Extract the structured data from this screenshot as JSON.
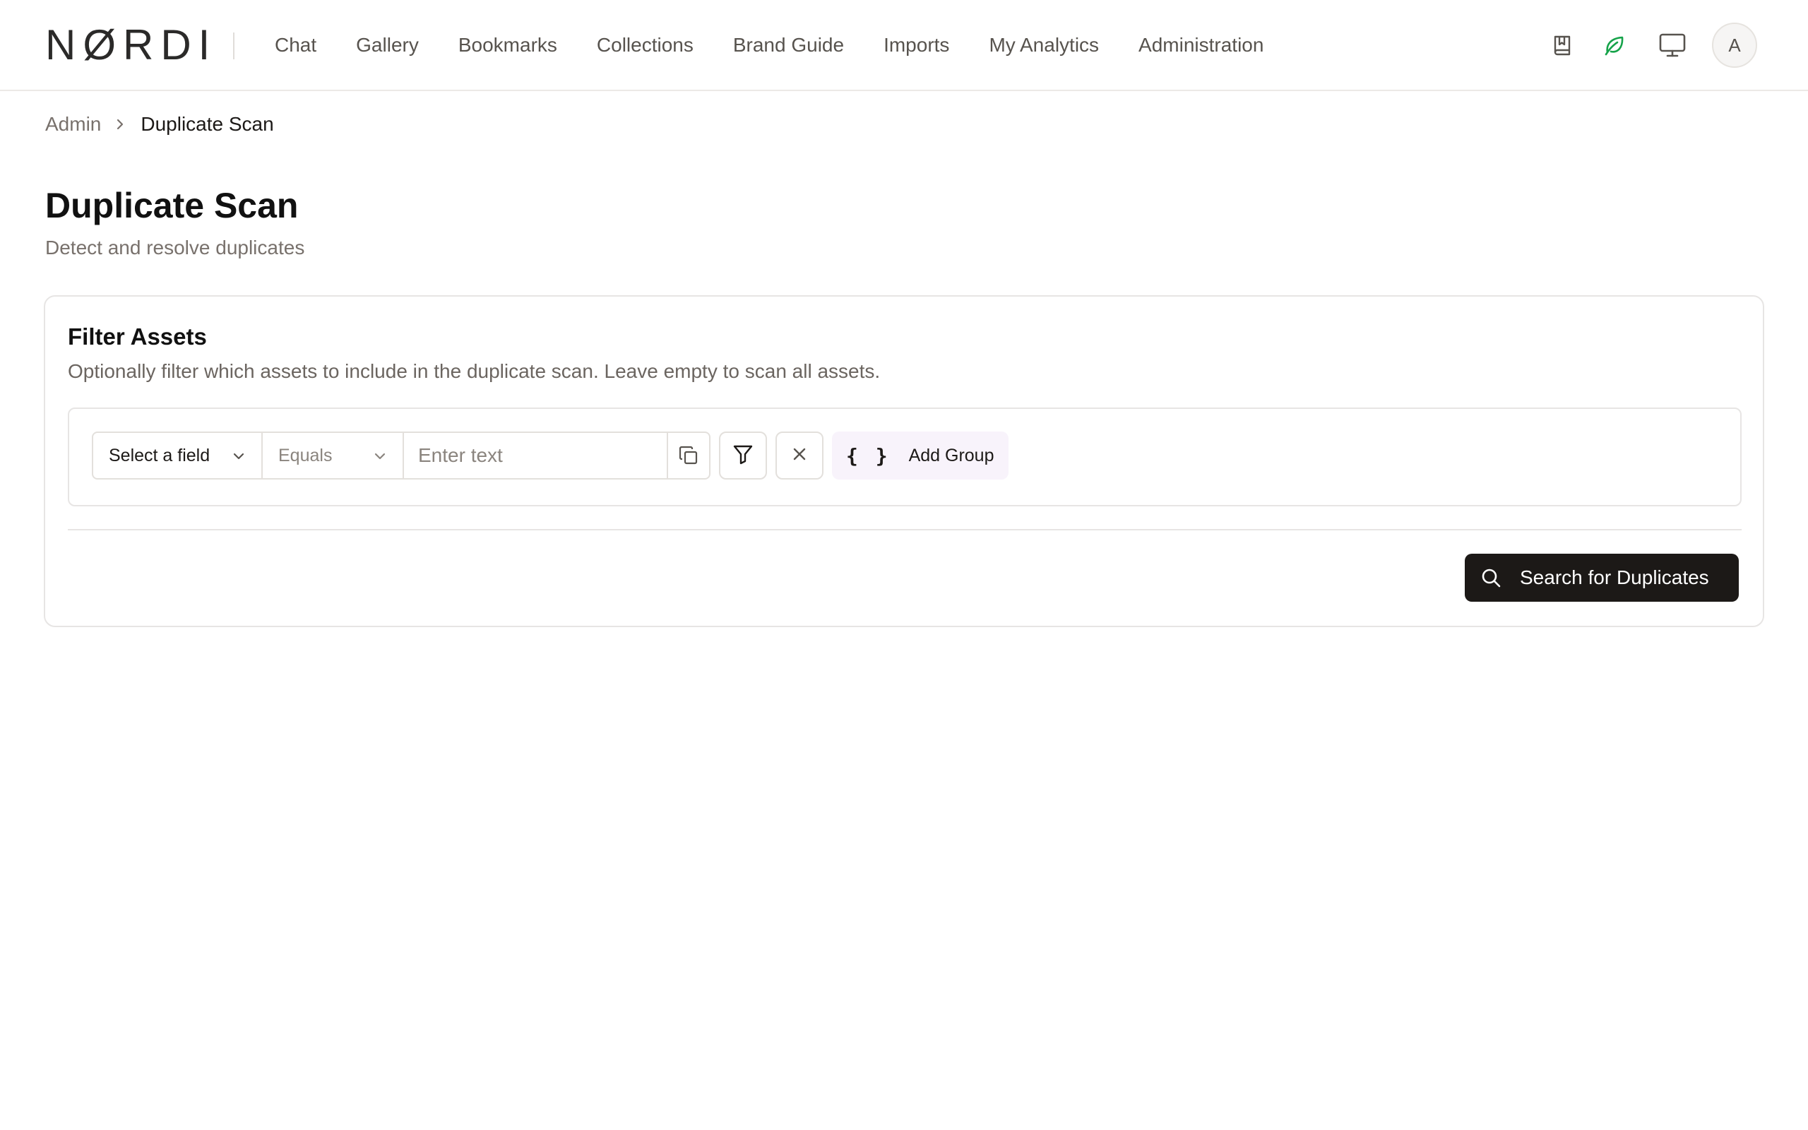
{
  "brand": {
    "logo_text": "NØRDI"
  },
  "nav": {
    "items": [
      {
        "label": "Chat"
      },
      {
        "label": "Gallery"
      },
      {
        "label": "Bookmarks"
      },
      {
        "label": "Collections"
      },
      {
        "label": "Brand Guide"
      },
      {
        "label": "Imports"
      },
      {
        "label": "My Analytics"
      },
      {
        "label": "Administration"
      }
    ]
  },
  "header": {
    "icons": [
      "book-bookmark-icon",
      "leaf-icon",
      "monitor-icon"
    ],
    "avatar_initial": "A",
    "leaf_color": "#16a34a"
  },
  "breadcrumb": {
    "parent": "Admin",
    "current": "Duplicate Scan"
  },
  "page": {
    "title": "Duplicate Scan",
    "subtitle": "Detect and resolve duplicates"
  },
  "filter_card": {
    "title": "Filter Assets",
    "description": "Optionally filter which assets to include in the duplicate scan. Leave empty to scan all assets.",
    "field_select": "Select a field",
    "operator_select": "Equals",
    "text_placeholder": "Enter text",
    "add_group_label": "Add Group",
    "braces": "{ }"
  },
  "actions": {
    "search_label": "Search for Duplicates"
  },
  "colors": {
    "primary_button": "#1c1917",
    "add_group_bg": "#f8f3fb"
  }
}
